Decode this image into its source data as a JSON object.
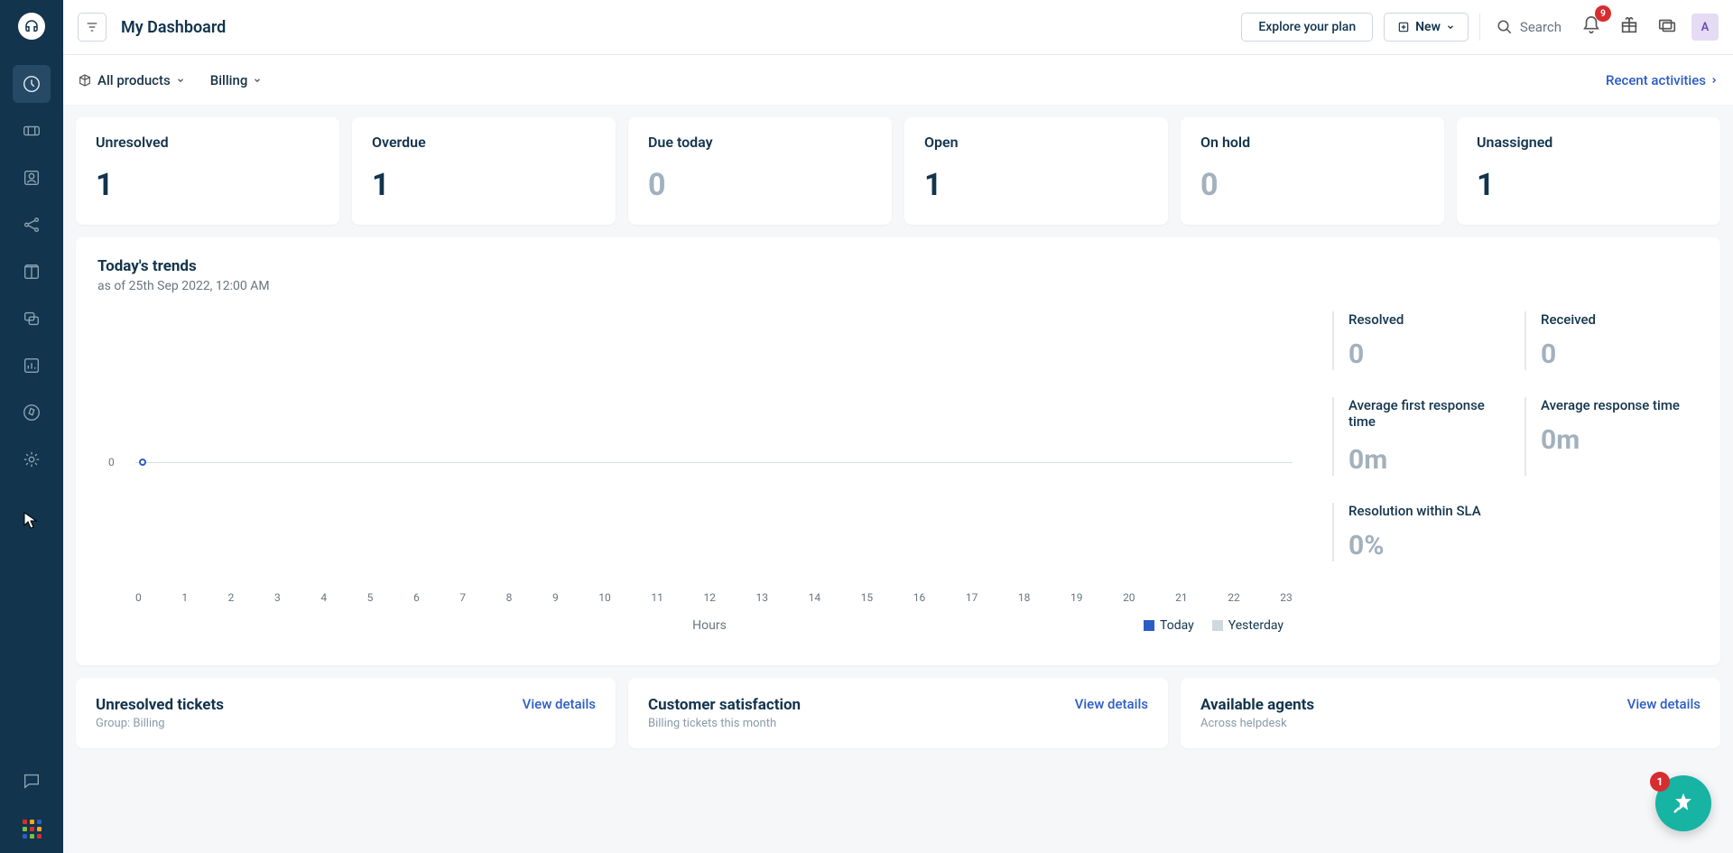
{
  "header": {
    "title": "My Dashboard",
    "explore_label": "Explore your plan",
    "new_label": "New",
    "search_placeholder": "Search",
    "notif_badge": "9",
    "avatar_initial": "A"
  },
  "subheader": {
    "products_label": "All products",
    "billing_label": "Billing",
    "recent_label": "Recent activities"
  },
  "stats": [
    {
      "label": "Unresolved",
      "value": "1",
      "zero": false
    },
    {
      "label": "Overdue",
      "value": "1",
      "zero": false
    },
    {
      "label": "Due today",
      "value": "0",
      "zero": true
    },
    {
      "label": "Open",
      "value": "1",
      "zero": false
    },
    {
      "label": "On hold",
      "value": "0",
      "zero": true
    },
    {
      "label": "Unassigned",
      "value": "1",
      "zero": false
    }
  ],
  "trends": {
    "title": "Today's trends",
    "subtitle": "as of 25th Sep 2022, 12:00 AM",
    "xlabel": "Hours",
    "legend_today": "Today",
    "legend_yesterday": "Yesterday",
    "metrics": [
      {
        "label": "Resolved",
        "value": "0",
        "single": true
      },
      {
        "label": "Received",
        "value": "0",
        "single": true
      },
      {
        "label": "Average first response time",
        "value": "0m",
        "single": false
      },
      {
        "label": "Average response time",
        "value": "0m",
        "single": true
      },
      {
        "label": "Resolution within SLA",
        "value": "0%",
        "single": true
      }
    ]
  },
  "bottom": [
    {
      "title": "Unresolved tickets",
      "sub": "Group: Billing",
      "link": "View details"
    },
    {
      "title": "Customer satisfaction",
      "sub": "Billing tickets this month",
      "link": "View details"
    },
    {
      "title": "Available agents",
      "sub": "Across helpdesk",
      "link": "View details"
    }
  ],
  "fab_badge": "1",
  "chart_data": {
    "type": "line",
    "title": "Today's trends",
    "xlabel": "Hours",
    "ylabel": "",
    "x": [
      0,
      1,
      2,
      3,
      4,
      5,
      6,
      7,
      8,
      9,
      10,
      11,
      12,
      13,
      14,
      15,
      16,
      17,
      18,
      19,
      20,
      21,
      22,
      23
    ],
    "xlim": [
      0,
      23
    ],
    "ylim": [
      0,
      1
    ],
    "series": [
      {
        "name": "Today",
        "color": "#2c5cc5",
        "values": [
          0
        ]
      },
      {
        "name": "Yesterday",
        "color": "#cfd7df",
        "values": []
      }
    ],
    "y_ticks": [
      0
    ]
  }
}
